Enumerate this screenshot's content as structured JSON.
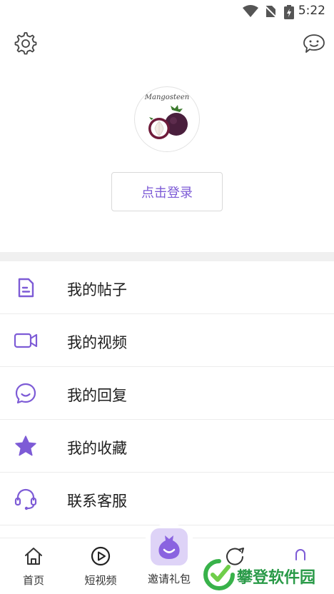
{
  "status_bar": {
    "time": "5:22"
  },
  "header": {
    "settings_icon": "gear-icon",
    "message_icon": "chat-bubble-icon"
  },
  "profile": {
    "avatar_brand": "Mangosteen",
    "login_button": "点击登录"
  },
  "accent_color": "#7d5bd6",
  "menu": {
    "items": [
      {
        "label": "我的帖子",
        "icon": "document-icon"
      },
      {
        "label": "我的视频",
        "icon": "video-camera-icon"
      },
      {
        "label": "我的回复",
        "icon": "smile-bubble-icon"
      },
      {
        "label": "我的收藏",
        "icon": "star-icon"
      },
      {
        "label": "联系客服",
        "icon": "headset-icon"
      }
    ]
  },
  "tabbar": {
    "tabs": [
      {
        "label": "首页",
        "icon": "home-icon"
      },
      {
        "label": "短视频",
        "icon": "play-circle-icon"
      },
      {
        "label": "邀请礼包",
        "icon": "gift-bag-icon"
      },
      {
        "label": "",
        "icon": "compass-icon"
      },
      {
        "label": "",
        "icon": "profile-icon"
      }
    ]
  },
  "watermark": {
    "text": "攀登软件园"
  }
}
